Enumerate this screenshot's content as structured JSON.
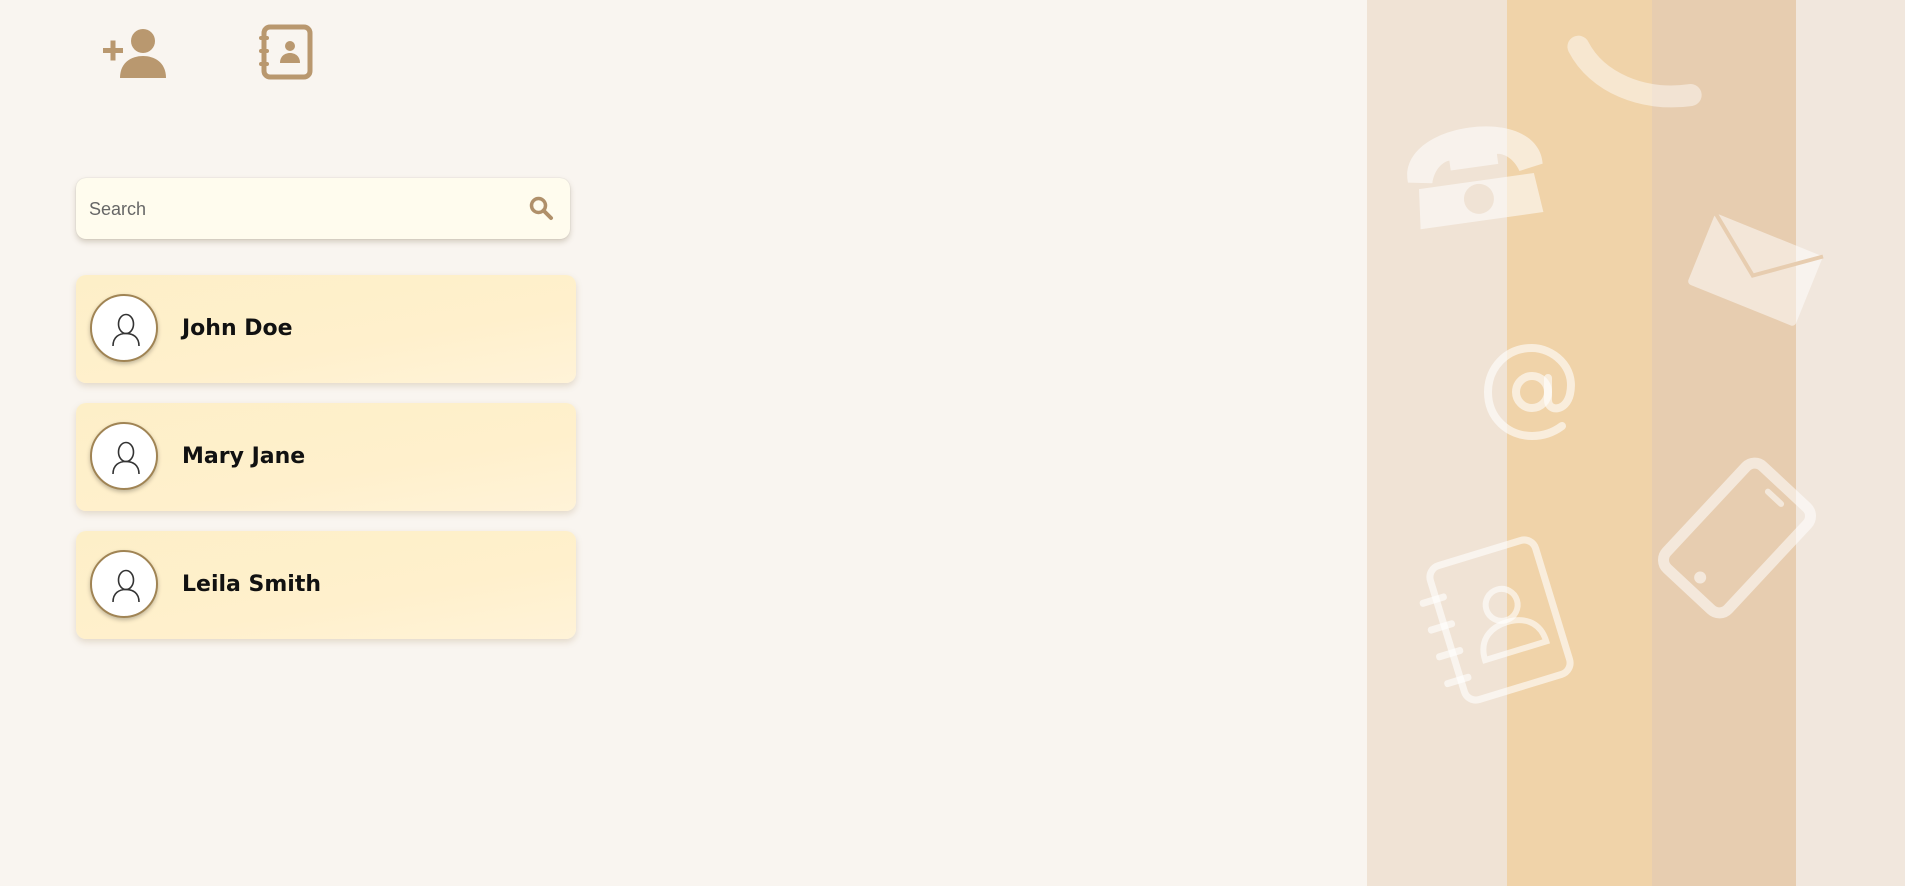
{
  "toolbar": {
    "add_contact_icon": "add-person-icon",
    "contacts_book_icon": "address-book-icon"
  },
  "search": {
    "placeholder": "Search",
    "value": "",
    "icon": "search-icon"
  },
  "contacts": [
    {
      "name": "John Doe",
      "avatar_icon": "user-outline-icon"
    },
    {
      "name": "Mary Jane",
      "avatar_icon": "user-outline-icon"
    },
    {
      "name": "Leila Smith",
      "avatar_icon": "user-outline-icon"
    }
  ],
  "decoration": {
    "stripe_colors": [
      "#f0e3d5",
      "#f0d3a9",
      "#e7cdb0",
      "#f1e7dd"
    ],
    "icons": [
      "telephone-icon",
      "phone-handset-icon",
      "envelope-icon",
      "at-sign-icon",
      "smartphone-icon",
      "address-book-icon"
    ]
  },
  "colors": {
    "background": "#f9f5f0",
    "accent": "#b9986f",
    "card": "#fff0cc",
    "search_bg": "#fffcee"
  }
}
